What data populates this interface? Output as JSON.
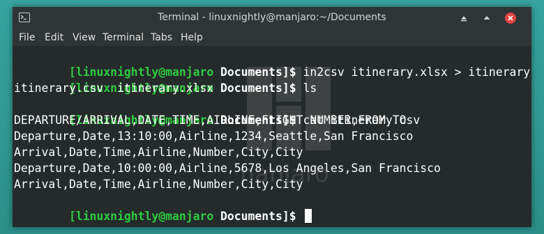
{
  "window": {
    "title": "Terminal - linuxnightly@manjaro:~/Documents"
  },
  "menu": [
    "File",
    "Edit",
    "View",
    "Terminal",
    "Tabs",
    "Help"
  ],
  "prompt": {
    "user_host": "[linuxnightly@manjaro",
    "dir": " Documents",
    "close": "]$"
  },
  "lines": [
    {
      "type": "prompt",
      "cmd": " in2csv itinerary.xlsx > itinerary.csv"
    },
    {
      "type": "prompt",
      "cmd": " ls"
    },
    {
      "type": "output",
      "text": "itinerary.csv  itinerary.xlsx"
    },
    {
      "type": "prompt",
      "cmd": " cat itinerary.csv"
    },
    {
      "type": "output",
      "text": "DEPARTURE/ARRIVAL,DATE,TIME,AIRLINE,FLIGHT NUMBER,FROM,TO"
    },
    {
      "type": "output",
      "text": "Departure,Date,13:10:00,Airline,1234,Seattle,San Francisco"
    },
    {
      "type": "output",
      "text": "Arrival,Date,Time,Airline,Number,City,City"
    },
    {
      "type": "output",
      "text": "Departure,Date,10:00:00,Airline,5678,Los Angeles,San Francisco"
    },
    {
      "type": "output",
      "text": "Arrival,Date,Time,Airline,Number,City,City"
    },
    {
      "type": "prompt",
      "cmd": " "
    }
  ],
  "watermark_text": "manjaro",
  "icons": {
    "app": "terminal-icon",
    "minimize": "minimize-icon",
    "maximize": "maximize-icon",
    "close": "close-icon"
  },
  "colors": {
    "prompt_user": "#2ecc40",
    "background": "#252a2b",
    "titlebar": "#2f3435",
    "close_button": "#e14444"
  }
}
